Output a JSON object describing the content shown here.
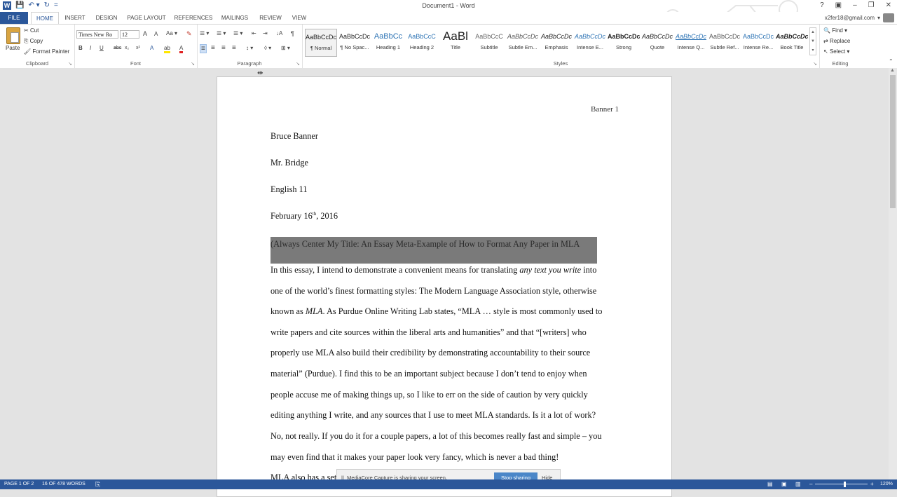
{
  "window": {
    "title": "Document1 - Word",
    "controls": [
      "?",
      "▣",
      "–",
      "❐",
      "✕"
    ]
  },
  "qat": {
    "logo": "W",
    "save": "💾",
    "undo": "↶ ▾",
    "redo": "↻",
    "customize": "="
  },
  "tabs": [
    "FILE",
    "HOME",
    "INSERT",
    "DESIGN",
    "PAGE LAYOUT",
    "REFERENCES",
    "MAILINGS",
    "REVIEW",
    "VIEW"
  ],
  "account": {
    "email": "x2fer18@gmail.com",
    "caret": "▾"
  },
  "clipboard": {
    "paste": "Paste",
    "cut": "Cut",
    "copy": "Copy",
    "format_painter": "Format Painter",
    "label": "Clipboard"
  },
  "font": {
    "name": "Times New Ro",
    "size": "12",
    "grow": "A",
    "shrink": "A",
    "case": "Aa ▾",
    "clear": "✎",
    "bold": "B",
    "italic": "I",
    "underline": "U",
    "strike": "abc",
    "sub": "x₂",
    "sup": "x²",
    "effects": "A",
    "highlight": "ab",
    "color": "A",
    "label": "Font"
  },
  "paragraph": {
    "bullets": "☰ ▾",
    "numbering": "☰ ▾",
    "multilevel": "☰ ▾",
    "decrease": "⇤",
    "increase": "⇥",
    "sort": "↓A",
    "pilcrow": "¶",
    "align_left": "≡",
    "center": "≡",
    "align_right": "≡",
    "justify": "≡",
    "spacing": "↕ ▾",
    "shading": "◊ ▾",
    "borders": "⊞ ▾",
    "label": "Paragraph"
  },
  "styles": {
    "label": "Styles",
    "items": [
      {
        "sample": "AaBbCcDc",
        "name": "¶ Normal"
      },
      {
        "sample": "AaBbCcDc",
        "name": "¶ No Spac..."
      },
      {
        "sample": "AaBbCc",
        "name": "Heading 1"
      },
      {
        "sample": "AaBbCcC",
        "name": "Heading 2"
      },
      {
        "sample": "AaBl",
        "name": "Title"
      },
      {
        "sample": "AaBbCcC",
        "name": "Subtitle"
      },
      {
        "sample": "AaBbCcDc",
        "name": "Subtle Em..."
      },
      {
        "sample": "AaBbCcDc",
        "name": "Emphasis"
      },
      {
        "sample": "AaBbCcDc",
        "name": "Intense E..."
      },
      {
        "sample": "AaBbCcDc",
        "name": "Strong"
      },
      {
        "sample": "AaBbCcDc",
        "name": "Quote"
      },
      {
        "sample": "AaBbCcDc",
        "name": "Intense Q..."
      },
      {
        "sample": "AaBbCcDc",
        "name": "Subtle Ref..."
      },
      {
        "sample": "AaBbCcDc",
        "name": "Intense Re..."
      },
      {
        "sample": "AaBbCcDc",
        "name": "Book Title"
      }
    ]
  },
  "editing": {
    "find": "Find ▾",
    "replace": "Replace",
    "select": "Select ▾",
    "label": "Editing"
  },
  "document": {
    "header": "Banner 1",
    "lines": [
      "Bruce Banner",
      "Mr. Bridge",
      "English 11"
    ],
    "date_pre": "February 16",
    "date_sup": "th",
    "date_post": ", 2016",
    "title": "(Always Center My Title: An Essay Meta-Example of How to Format Any Paper in MLA",
    "body": [
      "In this essay, I intend to demonstrate a convenient means for translating any text you write into",
      "one of the world’s finest formatting styles: The Modern Language Association style, otherwise",
      "known as MLA. As Purdue Online Writing Lab states, “MLA … style is most commonly used to",
      "write papers and cite sources within the liberal arts and humanities” and that “[writers] who",
      "properly use MLA also build their credibility by demonstrating accountability to their source",
      "material” (Purdue). I find this to be an important subject because I don’t tend to enjoy when",
      "people accuse me of making things up, so I like to err on the side of caution by very quickly",
      "editing anything I write, and any sources that I use to meet MLA standards. Is it a lot of work?",
      "No, not really. If you do it for a couple papers, a lot of this becomes really fast and simple – you",
      "may even find that it makes your paper look very fancy, which is never a bad thing!",
      "MLA also has a set of rules that protects writers from false accusations of"
    ]
  },
  "sharing_banner": {
    "icon": "||",
    "text": "MediaCore Capture is sharing your screen.",
    "stop": "Stop sharing",
    "hide": "Hide"
  },
  "statusbar": {
    "page": "PAGE 1 OF 2",
    "words": "16 OF 478 WORDS",
    "proof": "⎘",
    "zoom": "120%"
  }
}
